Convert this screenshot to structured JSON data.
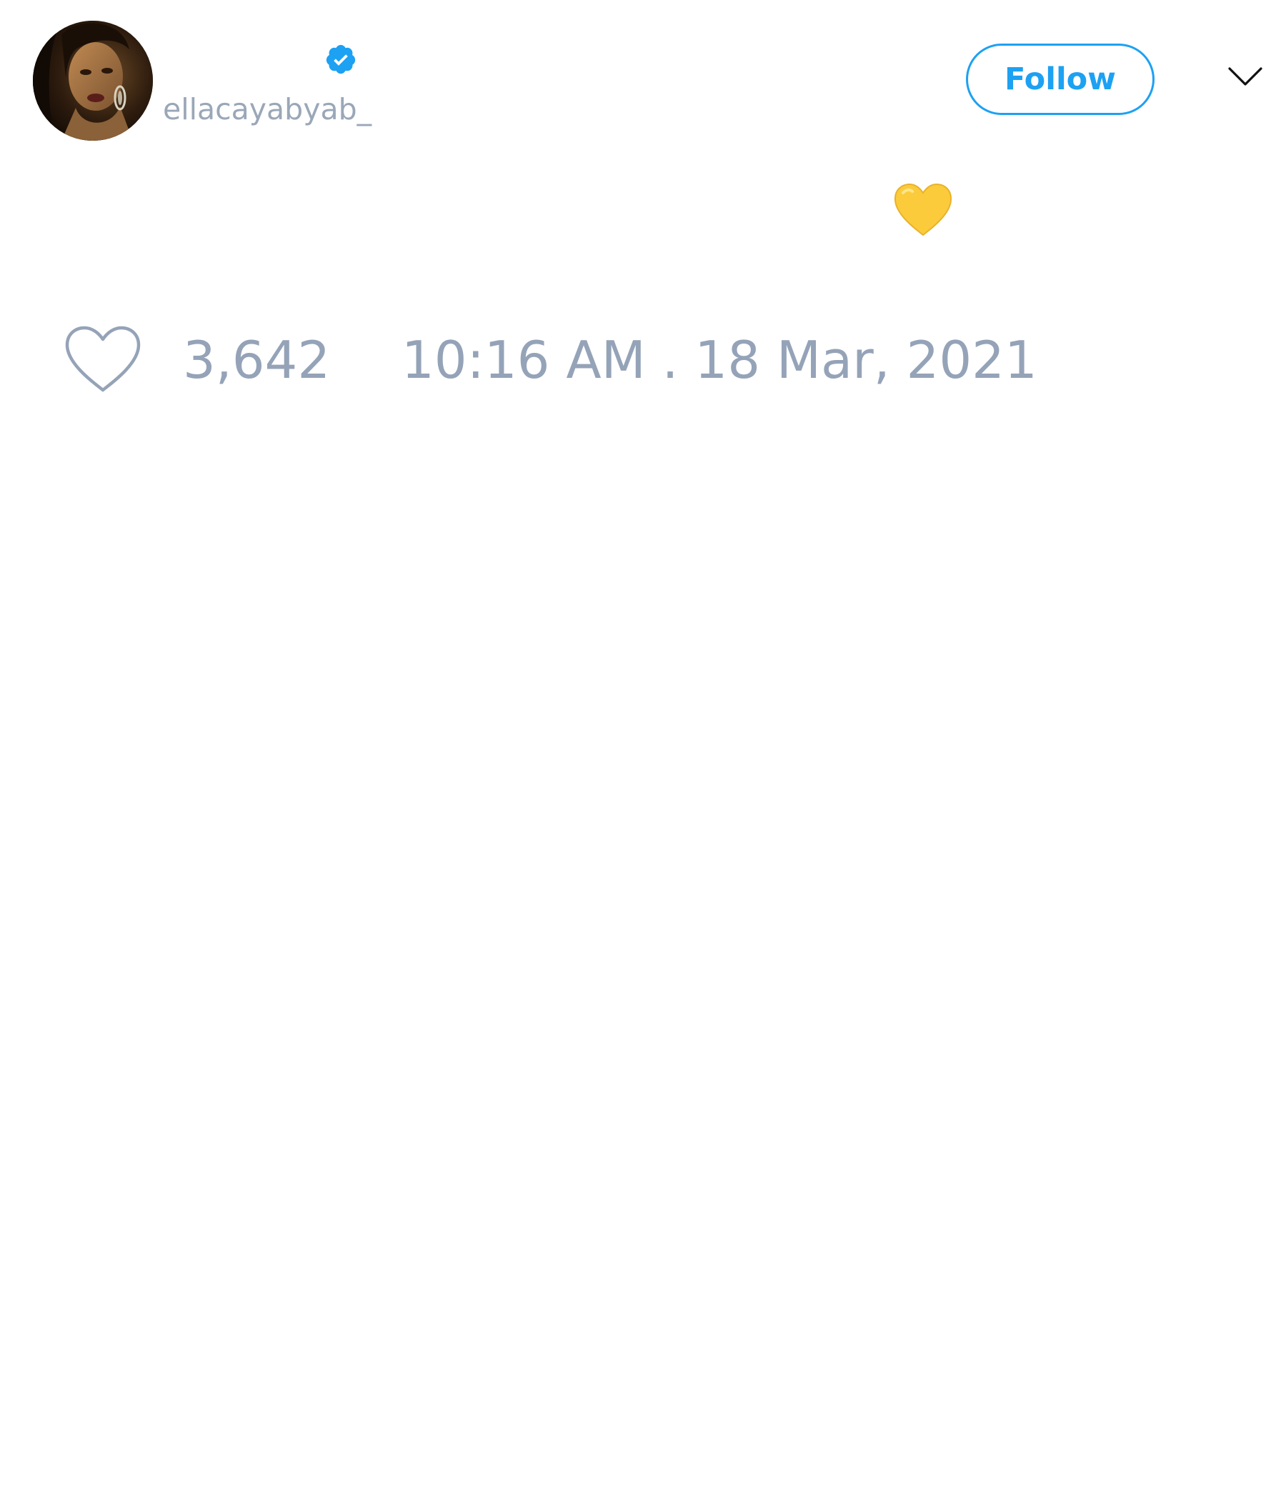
{
  "user": {
    "handle": "ellacayabyab_",
    "verified_icon": "verified-badge-icon",
    "avatar": "profile-photo"
  },
  "header": {
    "follow_label": "Follow",
    "menu_icon": "chevron-down-icon"
  },
  "tweet": {
    "emoji": "yellow-heart"
  },
  "footer": {
    "like_icon": "heart-outline-icon",
    "like_count": "3,642",
    "timestamp": "10:16 AM . 18 Mar, 2021"
  },
  "colors": {
    "accent": "#1da1f2",
    "muted_text": "#95a3b8",
    "emoji_yellow": "#fbcb3c"
  }
}
